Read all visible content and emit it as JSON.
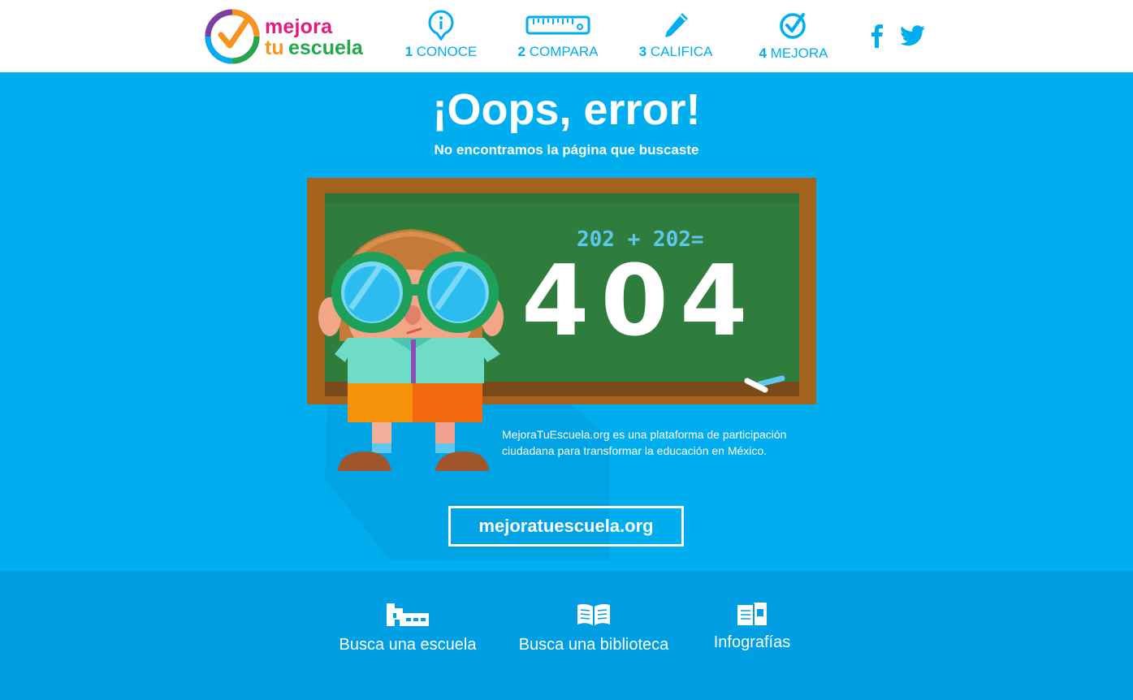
{
  "header": {
    "logo": {
      "word1": "mejora",
      "word2a": "tu",
      "word2b": "escuela"
    },
    "nav": [
      {
        "num": "1",
        "label": "CONOCE",
        "icon": "info-pin-icon"
      },
      {
        "num": "2",
        "label": "COMPARA",
        "icon": "ruler-icon"
      },
      {
        "num": "3",
        "label": "CALIFICA",
        "icon": "pencil-icon"
      },
      {
        "num": "4",
        "label": "MEJORA",
        "icon": "check-circle-icon"
      }
    ],
    "social": [
      "facebook-icon",
      "twitter-icon"
    ]
  },
  "hero": {
    "title": "¡Oops, error!",
    "subtitle": "No encontramos la página que buscaste",
    "chalkboard": {
      "equation": "202 + 202=",
      "result": "404"
    },
    "description_line1": "MejoraTuEscuela.org es una plataforma de participación",
    "description_line2": "ciudadana para transformar la educación en México.",
    "cta": "mejoratuescuela.org"
  },
  "footer": {
    "links": [
      {
        "label": "Busca una escuela",
        "icon": "school-icon"
      },
      {
        "label": "Busca una biblioteca",
        "icon": "open-book-icon"
      },
      {
        "label": "Infografías",
        "icon": "infographic-icon"
      }
    ]
  },
  "colors": {
    "brand_blue": "#00aef0",
    "footer_blue": "#009fe3",
    "magenta": "#e6197d",
    "orange": "#f7941d",
    "green": "#22a84a",
    "chalkboard": "#2e7d3c",
    "frame": "#a5621c"
  }
}
